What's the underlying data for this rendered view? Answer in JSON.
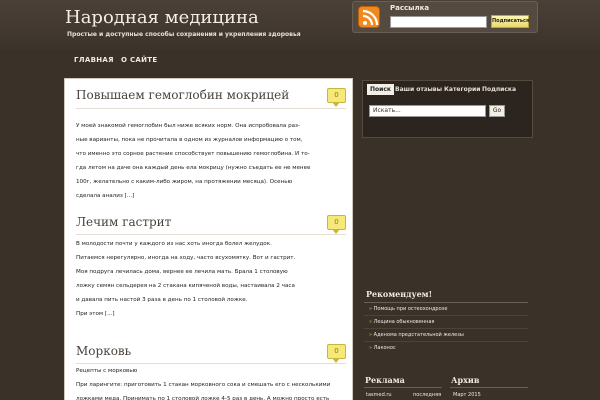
{
  "site": {
    "title": "Народная медицина",
    "description": "Простые и доступные способы сохранения и укрепления здоровья"
  },
  "subscribe": {
    "label": "Рассылка",
    "button": "Подписаться",
    "input_value": ""
  },
  "nav": {
    "items": [
      {
        "label": "ГЛАВНАЯ"
      },
      {
        "label": "О САЙТЕ"
      }
    ]
  },
  "posts": [
    {
      "title": "Повышаем гемоглобин мокрицей",
      "comments": "0",
      "lines": [
        "У моей знакомой гемоглобин был ниже всяких норм. Она испробовала раз-",
        "ные варианты, пока не прочитала в одном из журналов информацию о том,",
        "что именно это сорное растение способствует повышению гемоглобина. И то-",
        "гда летом на даче она каждый день ела мокрицу (нужно съедать ее не менее",
        "100г, желательно с каким-либо жиром, на протяжении месяца). Осенью",
        "сделала анализ [...]"
      ]
    },
    {
      "title": "Лечим гастрит",
      "comments": "0",
      "lines": [
        "В молодости почти у каждого из нас хоть иногда болел желудок.",
        "Питаемся нерегулярно, иногда на ходу, часто всухомятку. Вот и гастрит.",
        "Моя подруга лечилась дома, вернее ее лечила мать. Брала 1 столовую",
        "ложку семян сельдерея на 2 стакана кипяченой воды, настаивала 2 часа",
        "и давала пить настой 3 раза в день по 1 столовой ложке.",
        "При этом [...]"
      ]
    },
    {
      "title": "Морковь",
      "comments": "0",
      "lines": [
        "Рецепты с морковью",
        "При ларингите: приготовить 1 стакан морковного сока и смешать его с несколькими",
        "ложками меда. Принимать по 1 столовой ложке 4-5 раз в день. А можно просто есть больше"
      ]
    }
  ],
  "sidebar": {
    "tabs": [
      {
        "label": "Поиск"
      },
      {
        "label": "Ваши отзывы"
      },
      {
        "label": "Категории"
      },
      {
        "label": "Подписка"
      }
    ],
    "search_placeholder": "Искать...",
    "go_label": "Go",
    "recommend_title": "Рекомендуем!",
    "recommend_items": [
      "Помощь при остеохондрозе",
      "Лещина обыкновенная",
      "Аденома предстательной железы",
      "Лаконос"
    ],
    "ads_title": "Реклама",
    "ads_items": [
      {
        "left": "tasmed.ru",
        "right": "последняя"
      }
    ],
    "archive_title": "Архив",
    "archive_items": [
      "Март 2015"
    ]
  },
  "colors": {
    "background": "#3a3129",
    "rss_orange": "#f18a1e",
    "comment_yellow": "#f7e87a"
  },
  "icons": {
    "rss": "rss-icon",
    "comment": "comment-bubble-icon"
  }
}
